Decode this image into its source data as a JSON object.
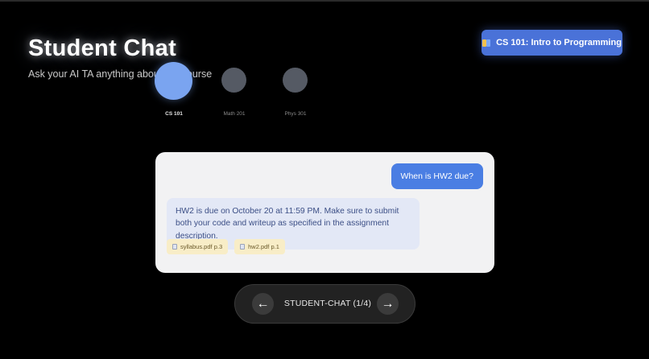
{
  "header": {
    "title": "Student Chat",
    "subtitle": "Ask your AI TA anything about the course"
  },
  "course_selector": {
    "label": "CS 101: Intro to Programming",
    "icon": "book-icon"
  },
  "courses": [
    {
      "label": "CS 101",
      "active": true
    },
    {
      "label": "Math 201",
      "active": false
    },
    {
      "label": "Phys 301",
      "active": false
    }
  ],
  "chat": {
    "user_message": "When is HW2 due?",
    "assistant_message": "HW2 is due on October 20 at 11:59 PM. Make sure to submit both your code and writeup as specified in the assignment description.",
    "citations": [
      {
        "label": "syllabus.pdf p.3",
        "icon": "document-icon"
      },
      {
        "label": "hw2.pdf p.1",
        "icon": "document-icon"
      }
    ]
  },
  "navigation": {
    "prev_label": "←",
    "next_label": "→",
    "slide_label": "STUDENT-CHAT (1/4)"
  },
  "colors": {
    "accent": "#4a72d8",
    "active_course": "#7aa4f0",
    "inactive_course": "#555a64",
    "user_bubble": "#4a7ee3",
    "assistant_bubble": "#e3e8f6",
    "citation_bg": "#f8edc7"
  }
}
